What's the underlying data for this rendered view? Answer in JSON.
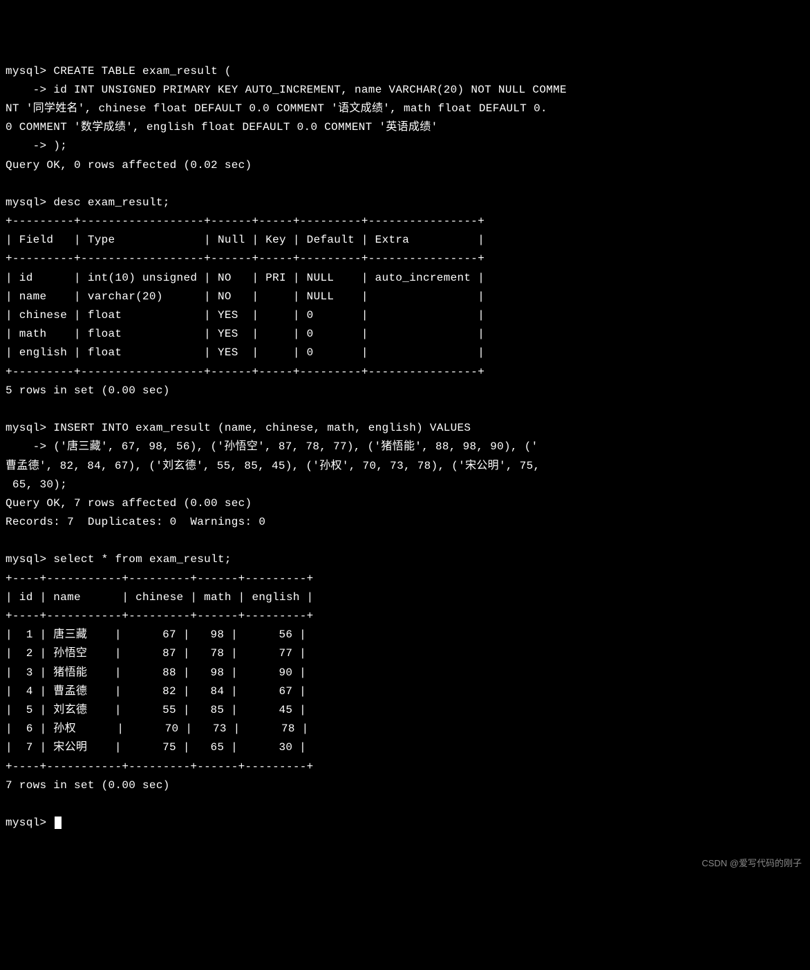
{
  "prompt": "mysql>",
  "cont": "    ->",
  "cmd1_l1": "CREATE TABLE exam_result (",
  "cmd1_l2": "id INT UNSIGNED PRIMARY KEY AUTO_INCREMENT, name VARCHAR(20) NOT NULL COMME",
  "cmd1_l3": "NT '同学姓名', chinese float DEFAULT 0.0 COMMENT '语文成绩', math float DEFAULT 0.",
  "cmd1_l4": "0 COMMENT '数学成绩', english float DEFAULT 0.0 COMMENT '英语成绩'",
  "cmd1_l5": ");",
  "resp1": "Query OK, 0 rows affected (0.02 sec)",
  "cmd2": "desc exam_result;",
  "desc_sep": "+---------+------------------+------+-----+---------+----------------+",
  "desc_hdr": "| Field   | Type             | Null | Key | Default | Extra          |",
  "desc_rows": [
    "| id      | int(10) unsigned | NO   | PRI | NULL    | auto_increment |",
    "| name    | varchar(20)      | NO   |     | NULL    |                |",
    "| chinese | float            | YES  |     | 0       |                |",
    "| math    | float            | YES  |     | 0       |                |",
    "| english | float            | YES  |     | 0       |                |"
  ],
  "desc_footer": "5 rows in set (0.00 sec)",
  "cmd3_l1": "INSERT INTO exam_result (name, chinese, math, english) VALUES",
  "cmd3_l2": "('唐三藏', 67, 98, 56), ('孙悟空', 87, 78, 77), ('猪悟能', 88, 98, 90), ('",
  "cmd3_l3": "曹孟德', 82, 84, 67), ('刘玄德', 55, 85, 45), ('孙权', 70, 73, 78), ('宋公明', 75,",
  "cmd3_l4": " 65, 30);",
  "resp3_l1": "Query OK, 7 rows affected (0.00 sec)",
  "resp3_l2": "Records: 7  Duplicates: 0  Warnings: 0",
  "cmd4": "select * from exam_result;",
  "sel_sep": "+----+-----------+---------+------+---------+",
  "sel_hdr": "| id | name      | chinese | math | english |",
  "sel_rows": [
    "|  1 | 唐三藏    |      67 |   98 |      56 |",
    "|  2 | 孙悟空    |      87 |   78 |      77 |",
    "|  3 | 猪悟能    |      88 |   98 |      90 |",
    "|  4 | 曹孟德    |      82 |   84 |      67 |",
    "|  5 | 刘玄德    |      55 |   85 |      45 |",
    "|  6 | 孙权      |      70 |   73 |      78 |",
    "|  7 | 宋公明    |      75 |   65 |      30 |"
  ],
  "sel_footer": "7 rows in set (0.00 sec)",
  "watermark": "CSDN @爱写代码的刚子",
  "chart_data": {
    "type": "table",
    "desc_table": {
      "columns": [
        "Field",
        "Type",
        "Null",
        "Key",
        "Default",
        "Extra"
      ],
      "rows": [
        [
          "id",
          "int(10) unsigned",
          "NO",
          "PRI",
          "NULL",
          "auto_increment"
        ],
        [
          "name",
          "varchar(20)",
          "NO",
          "",
          "NULL",
          ""
        ],
        [
          "chinese",
          "float",
          "YES",
          "",
          "0",
          ""
        ],
        [
          "math",
          "float",
          "YES",
          "",
          "0",
          ""
        ],
        [
          "english",
          "float",
          "YES",
          "",
          "0",
          ""
        ]
      ]
    },
    "select_table": {
      "columns": [
        "id",
        "name",
        "chinese",
        "math",
        "english"
      ],
      "rows": [
        [
          1,
          "唐三藏",
          67,
          98,
          56
        ],
        [
          2,
          "孙悟空",
          87,
          78,
          77
        ],
        [
          3,
          "猪悟能",
          88,
          98,
          90
        ],
        [
          4,
          "曹孟德",
          82,
          84,
          67
        ],
        [
          5,
          "刘玄德",
          55,
          85,
          45
        ],
        [
          6,
          "孙权",
          70,
          73,
          78
        ],
        [
          7,
          "宋公明",
          75,
          65,
          30
        ]
      ]
    }
  }
}
